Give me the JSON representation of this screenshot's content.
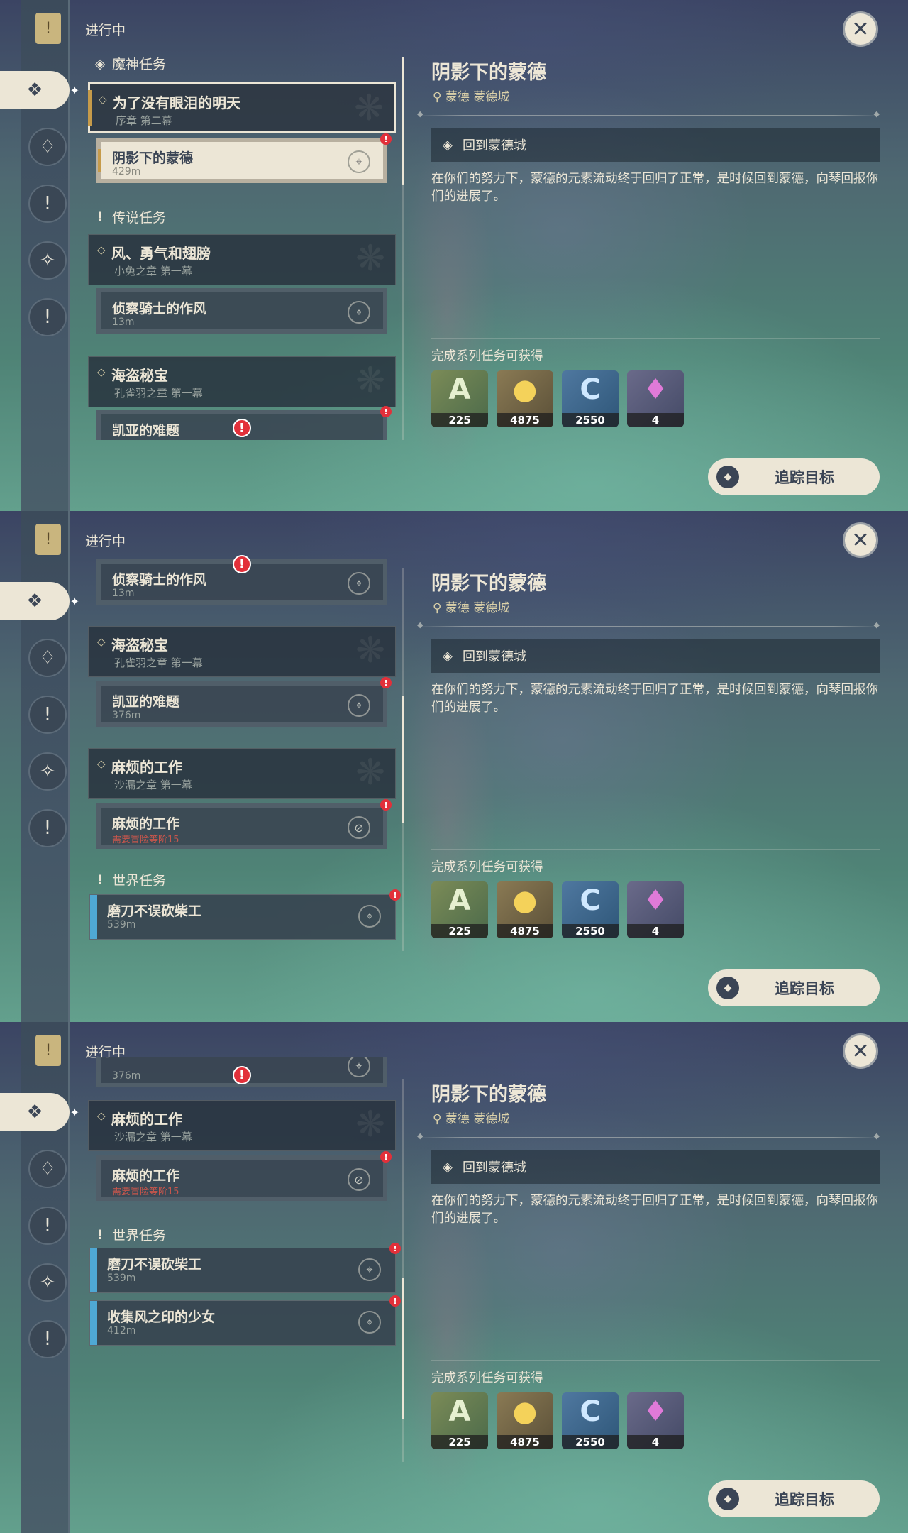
{
  "header": {
    "in_progress": "进行中"
  },
  "categories": {
    "archon": "魔神任务",
    "story": "传说任务",
    "world": "世界任务"
  },
  "chapters": [
    {
      "title": "为了没有眼泪的明天",
      "sub": "序章 第二幕"
    },
    {
      "title": "风、勇气和翅膀",
      "sub": "小兔之章 第一幕"
    },
    {
      "title": "海盗秘宝",
      "sub": "孔雀羽之章 第一幕"
    },
    {
      "title": "麻烦的工作",
      "sub": "沙漏之章 第一幕"
    }
  ],
  "quests": [
    {
      "title": "阴影下的蒙德",
      "dist": "429m"
    },
    {
      "title": "侦察骑士的作风",
      "dist": "13m"
    },
    {
      "title": "凯亚的难题",
      "dist": "376m"
    },
    {
      "title": "麻烦的工作",
      "req": "需要冒险等阶15"
    }
  ],
  "world_quests": [
    {
      "title": "磨刀不误砍柴工",
      "dist": "539m"
    },
    {
      "title": "收集风之印的少女",
      "dist": "412m"
    }
  ],
  "detail": {
    "title": "阴影下的蒙德",
    "location": "蒙德 蒙德城",
    "objective": "回到蒙德城",
    "description": "在你们的努力下，蒙德的元素流动终于回归了正常，是时候回到蒙德，向琴回报你们的进展了。",
    "rewards_label": "完成系列任务可获得",
    "rewards": [
      {
        "icon": "adventure-exp-icon",
        "count": "225"
      },
      {
        "icon": "mora-icon",
        "count": "4875"
      },
      {
        "icon": "character-exp-icon",
        "count": "2550"
      },
      {
        "icon": "crystal-icon",
        "count": "4"
      }
    ],
    "track_button": "追踪目标"
  },
  "colors": {
    "accent": "#ece6d6",
    "gold": "#c69b4a",
    "alert": "#e2303a",
    "world_bar": "#4fa8d4"
  }
}
